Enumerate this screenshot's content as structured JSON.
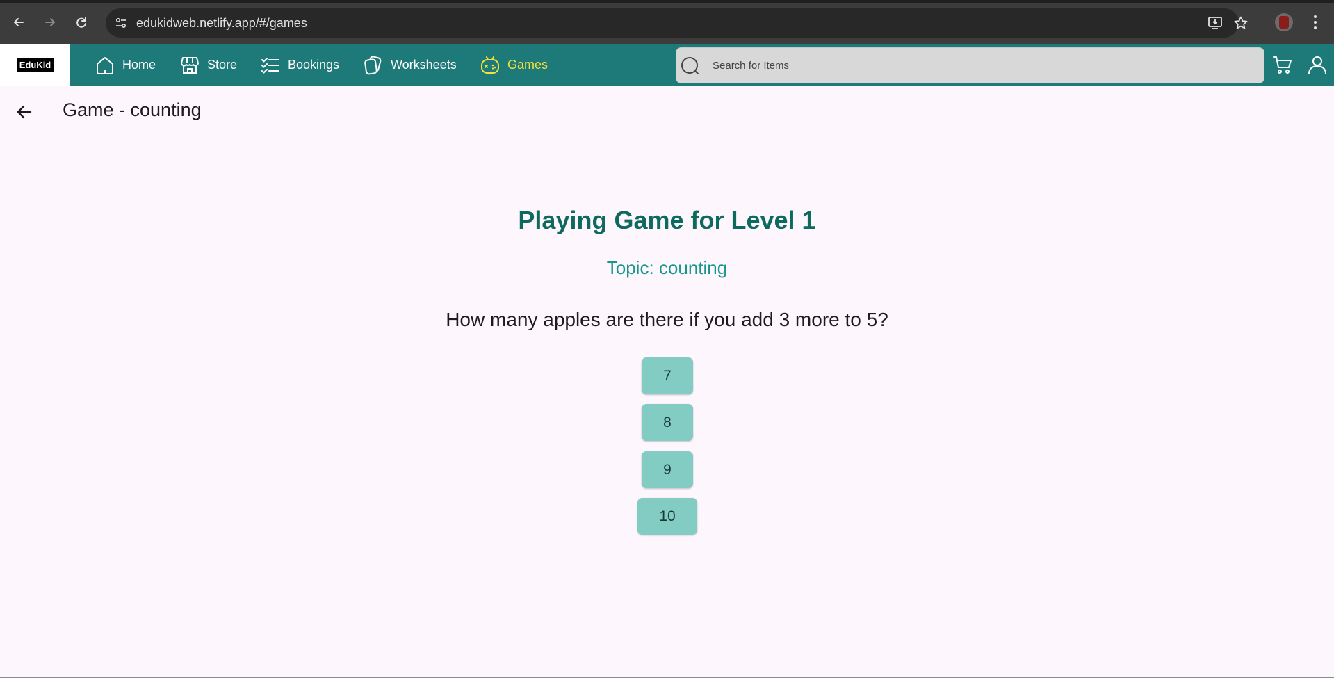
{
  "browser": {
    "url": "edukidweb.netlify.app/#/games"
  },
  "header": {
    "logo_text": "EduKid",
    "nav": [
      {
        "label": "Home",
        "icon": "home-icon",
        "active": false
      },
      {
        "label": "Store",
        "icon": "store-icon",
        "active": false
      },
      {
        "label": "Bookings",
        "icon": "checklist-icon",
        "active": false
      },
      {
        "label": "Worksheets",
        "icon": "worksheets-icon",
        "active": false
      },
      {
        "label": "Games",
        "icon": "gamepad-icon",
        "active": true
      }
    ],
    "search_placeholder": "Search for Items"
  },
  "page": {
    "title": "Game - counting",
    "game_title": "Playing Game for Level 1",
    "topic": "Topic: counting",
    "question": "How many apples are there if you add 3 more to 5?",
    "answers": [
      "7",
      "8",
      "9",
      "10"
    ]
  },
  "colors": {
    "header_bg": "#1e7a78",
    "active_nav": "#f4e23a",
    "game_title": "#0e6a5f",
    "topic": "#17978c",
    "answer_bg": "#82ccc3",
    "page_bg": "#fdf7fd"
  }
}
